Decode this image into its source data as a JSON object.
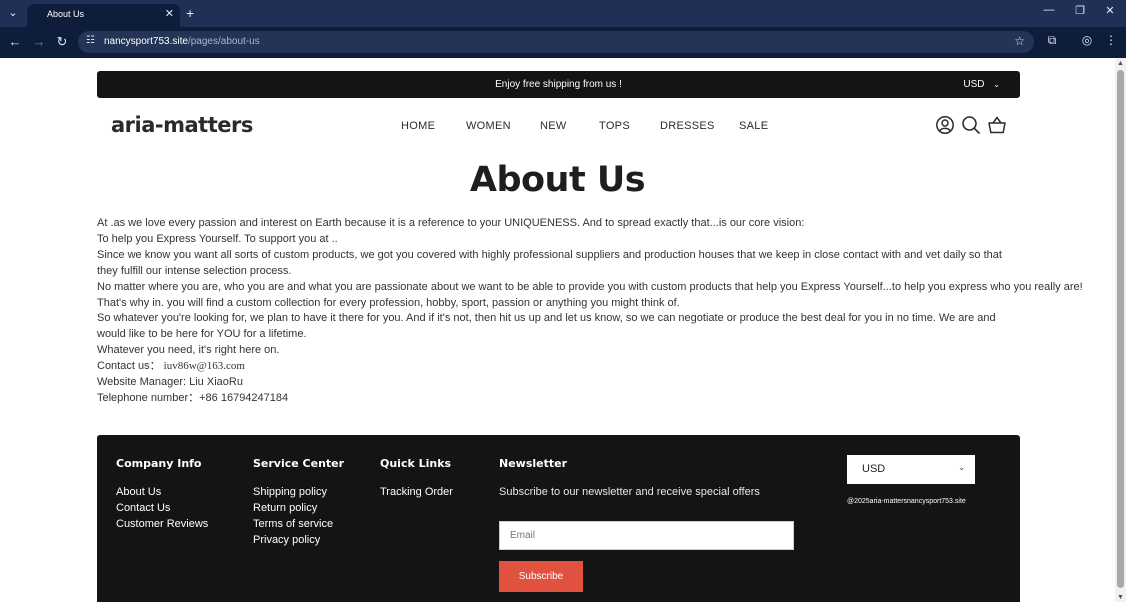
{
  "browser": {
    "tab_title": "About Us",
    "url_host": "nancysport753.site",
    "url_path": "/pages/about-us"
  },
  "announcement": {
    "text": "Enjoy free shipping from us !",
    "currency": "USD"
  },
  "header": {
    "logo": "aria-matters",
    "nav": [
      "HOME",
      "WOMEN",
      "NEW",
      "TOPS",
      "DRESSES",
      "SALE"
    ]
  },
  "page": {
    "title": "About Us",
    "lines": [
      "At .as we love every passion and interest on  Earth because it is a reference to your UNIQUENESS. And to spread exactly that...is our core vision:",
      "To help you  Express Yourself. To support you at ..",
      "Since we know you want all sorts of custom products, we got you covered with highly professional suppliers and production houses that we keep in close contact with and vet daily so that they fulfill our intense selection process.",
      "No matter where you are, who you are and what you are passionate about we want to be able to provide you with custom products that help you  Express Yourself...to help you express who you really are!",
      "That's why in. you will find a custom collection for every profession, hobby, sport, passion or anything you might think of.",
      "So whatever you're looking for, we plan to have it there for you. And if it's not, then hit us up and let us know, so we can negotiate or produce the best deal for you in no time. We are and would like to be here for YOU for a lifetime.",
      "Whatever you need, it's right here on."
    ],
    "contact_label": "Contact us：",
    "contact_email": "iuv86w@163.com",
    "manager": "Website  Manager:  Liu XiaoRu",
    "phone": "Telephone number：+86 16794247184"
  },
  "footer": {
    "company": {
      "title": "Company Info",
      "links": [
        "About Us",
        "Contact Us",
        "Customer  Reviews"
      ]
    },
    "service": {
      "title": "Service Center",
      "links": [
        "Shipping policy",
        "Return policy",
        "Terms of service",
        "Privacy policy"
      ]
    },
    "quick": {
      "title": "Quick Links",
      "links": [
        "Tracking Order"
      ]
    },
    "newsletter": {
      "title": "Newsletter",
      "subtitle": "Subscribe to our newsletter and receive special offers",
      "email_placeholder": "Email",
      "button": "Subscribe"
    },
    "currency": "USD",
    "copyright": "@2025aria-mattersnancysport753.site"
  },
  "icons": {
    "tab_menu": "chevron-down-icon",
    "close": "close-icon",
    "new_tab": "plus-icon",
    "back": "back-arrow-icon",
    "forward": "forward-arrow-icon",
    "reload": "reload-icon",
    "site_info": "tune-icon",
    "bookmark": "star-icon",
    "extensions": "puzzle-icon",
    "profile": "account-icon",
    "menu": "kebab-menu-icon",
    "search": "search-icon",
    "cart": "basket-icon"
  },
  "colors": {
    "browser_frame": "#1f2f55",
    "browser_toolbar": "#0f1d3d",
    "announcement_bg": "#141414",
    "footer_bg": "#141414",
    "subscribe_button": "#e0523f"
  }
}
